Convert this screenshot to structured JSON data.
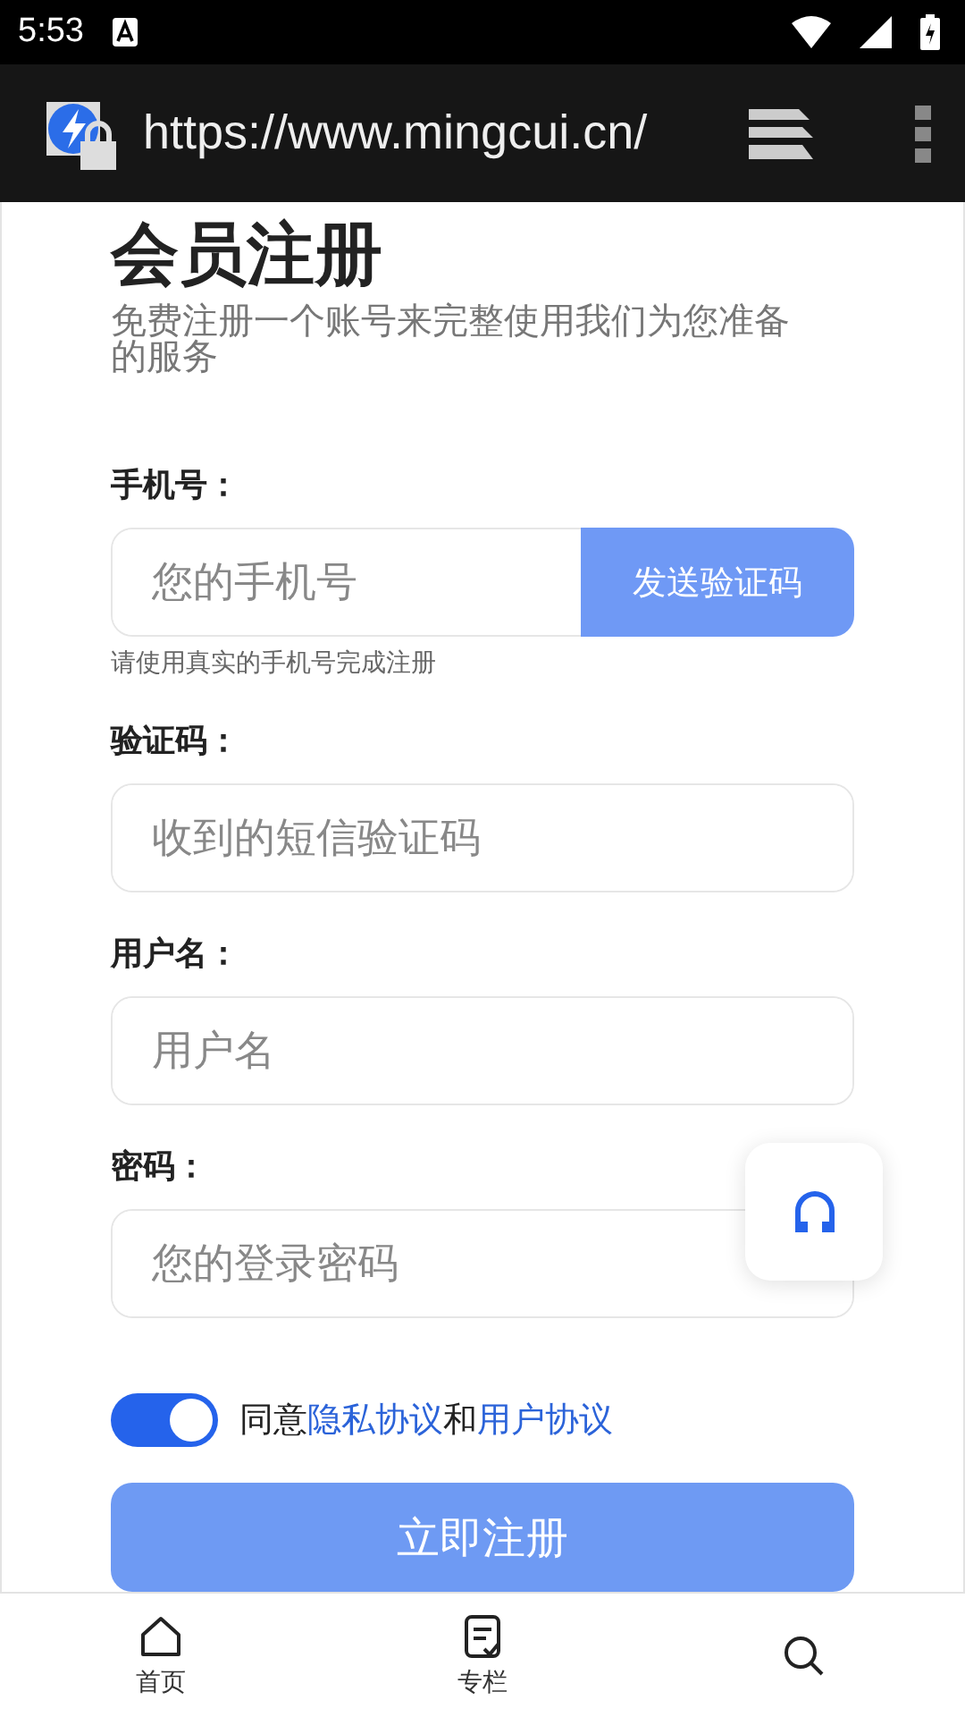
{
  "status_bar": {
    "time": "5:53"
  },
  "browser": {
    "url": "https://www.mingcui.cn/"
  },
  "form": {
    "title": "会员注册",
    "subtitle": "免费注册一个账号来完整使用我们为您准备的服务",
    "fields": [
      {
        "kind": "sms",
        "label": "手机号：",
        "placeholder": "您的手机号",
        "button": "发送验证码",
        "hint": "请使用真实的手机号完成注册"
      },
      {
        "kind": "text",
        "label": "验证码：",
        "placeholder": "收到的短信验证码"
      },
      {
        "kind": "text",
        "label": "用户名：",
        "placeholder": "用户名"
      },
      {
        "kind": "password",
        "label": "密码：",
        "placeholder": "您的登录密码"
      }
    ],
    "agreement": {
      "on": true,
      "parts": [
        {
          "kind": "text",
          "text": "同意"
        },
        {
          "kind": "link",
          "text": "隐私协议"
        },
        {
          "kind": "text",
          "text": "和"
        },
        {
          "kind": "link",
          "text": "用户协议"
        }
      ]
    },
    "submit": "立即注册"
  },
  "bottom_nav": [
    {
      "kind": "home",
      "label": "首页"
    },
    {
      "kind": "column",
      "label": "专栏"
    },
    {
      "kind": "search"
    }
  ]
}
